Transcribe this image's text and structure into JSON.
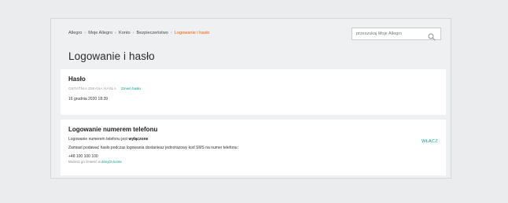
{
  "breadcrumb": {
    "items": [
      "Allegro",
      "Moje Allegro",
      "Konto",
      "Bezpieczeństwo"
    ],
    "current": "Logowanie i hasło",
    "separator": "›"
  },
  "search": {
    "placeholder": "przeszukaj Moje Allegro",
    "icon": "search-icon"
  },
  "page_title": "Logowanie i hasło",
  "password_card": {
    "title": "Hasło",
    "last_change_label": "OSTATNIA ZMIANA HASŁA",
    "change_link": "Zmień hasło",
    "last_change_date": "16 grudnia 2020 18:39"
  },
  "phone_card": {
    "title": "Logowanie numerem telefonu",
    "status_prefix": "Logowanie numerem telefonu jest",
    "status_value": "wyłączone",
    "description": "Zamiast podawać hasło podczas logowania dostaniesz jednorazowy kod SMS na numer telefonu:",
    "phone_number": "+48 100 100 100",
    "hint_prefix": "Możesz go zmienić w",
    "hint_link": "danych konta",
    "enable_label": "WŁĄCZ"
  },
  "colors": {
    "accent": "#00a790",
    "breadcrumb_current": "#ff5a00",
    "background": "#eaeced"
  }
}
